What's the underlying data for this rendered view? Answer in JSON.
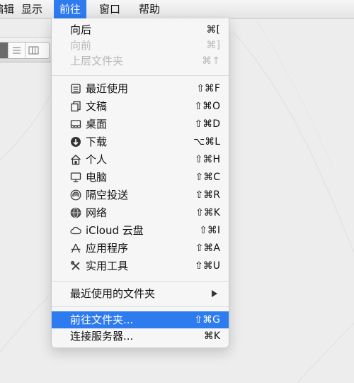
{
  "menubar": {
    "items": [
      {
        "label": "编辑"
      },
      {
        "label": "显示"
      },
      {
        "label": "前往"
      },
      {
        "label": "窗口"
      },
      {
        "label": "帮助"
      }
    ]
  },
  "go_menu": {
    "back": {
      "label": "向后",
      "shortcut": "⌘["
    },
    "forward": {
      "label": "向前",
      "shortcut": "⌘]"
    },
    "enclosing": {
      "label": "上层文件夹",
      "shortcut": "⌘↑"
    },
    "recents": {
      "label": "最近使用",
      "shortcut": "⇧⌘F",
      "icon": "recents-icon"
    },
    "documents": {
      "label": "文稿",
      "shortcut": "⇧⌘O",
      "icon": "documents-icon"
    },
    "desktop": {
      "label": "桌面",
      "shortcut": "⇧⌘D",
      "icon": "desktop-icon"
    },
    "downloads": {
      "label": "下载",
      "shortcut": "⌥⌘L",
      "icon": "downloads-icon"
    },
    "home": {
      "label": "个人",
      "shortcut": "⇧⌘H",
      "icon": "home-icon"
    },
    "computer": {
      "label": "电脑",
      "shortcut": "⇧⌘C",
      "icon": "computer-icon"
    },
    "airdrop": {
      "label": "隔空投送",
      "shortcut": "⇧⌘R",
      "icon": "airdrop-icon"
    },
    "network": {
      "label": "网络",
      "shortcut": "⇧⌘K",
      "icon": "network-icon"
    },
    "icloud": {
      "label": "iCloud 云盘",
      "shortcut": "⇧⌘I",
      "icon": "icloud-icon"
    },
    "applications": {
      "label": "应用程序",
      "shortcut": "⇧⌘A",
      "icon": "applications-icon"
    },
    "utilities": {
      "label": "实用工具",
      "shortcut": "⇧⌘U",
      "icon": "utilities-icon"
    },
    "recent_folders": {
      "label": "最近使用的文件夹"
    },
    "go_to_folder": {
      "label": "前往文件夹...",
      "shortcut": "⇧⌘G"
    },
    "connect_server": {
      "label": "连接服务器...",
      "shortcut": "⌘K"
    }
  },
  "colors": {
    "highlight": "#2e7bf0",
    "disabled_text": "#b8b8b8"
  }
}
